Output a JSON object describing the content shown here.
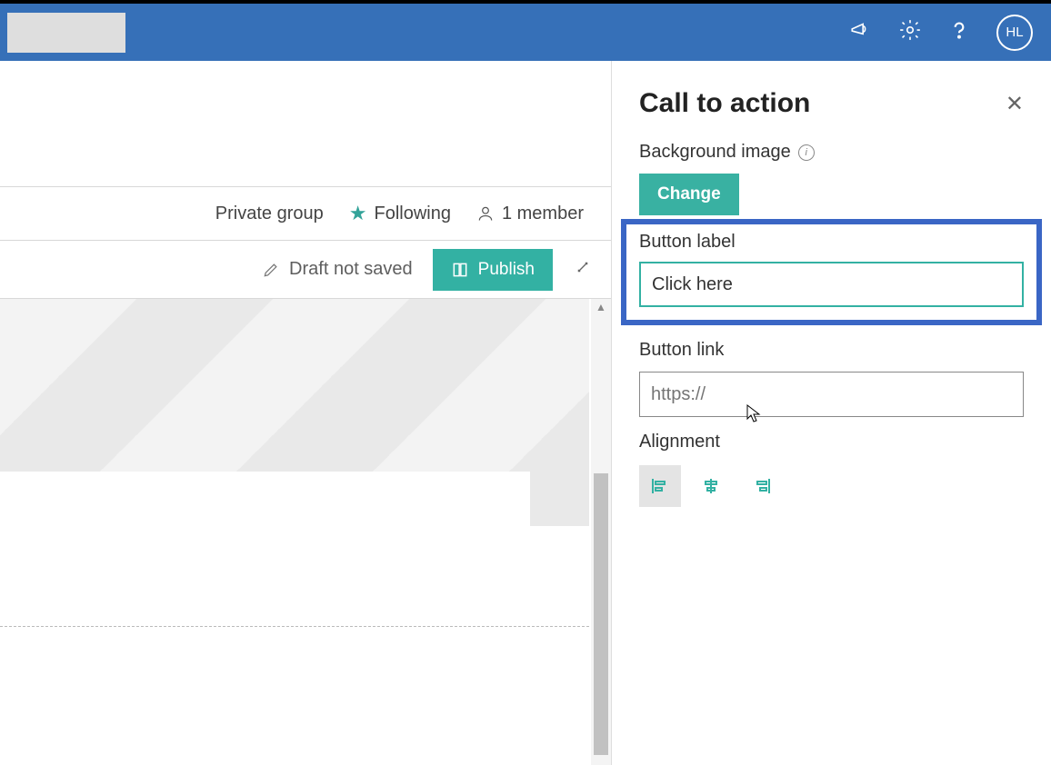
{
  "header": {
    "avatar": "HL"
  },
  "group_bar": {
    "privacy": "Private group",
    "following": "Following",
    "members": "1 member"
  },
  "action_bar": {
    "draft_status": "Draft not saved",
    "publish_label": "Publish"
  },
  "panel": {
    "title": "Call to action",
    "background_label": "Background image",
    "change_label": "Change",
    "button_label_label": "Button label",
    "button_label_value": "Click here",
    "button_link_label": "Button link",
    "button_link_placeholder": "https://",
    "alignment_label": "Alignment"
  }
}
